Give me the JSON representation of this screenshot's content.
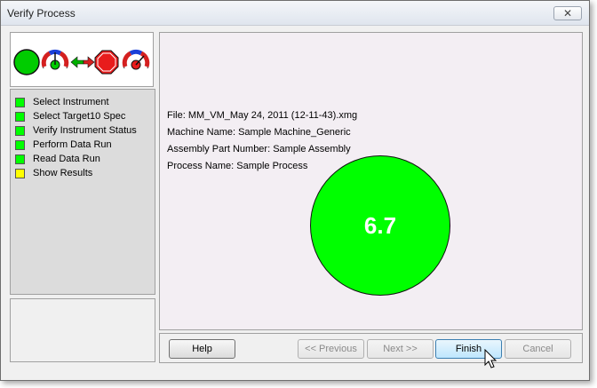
{
  "window": {
    "title": "Verify Process",
    "close_label": "✕"
  },
  "icons": [
    {
      "name": "green-light-icon"
    },
    {
      "name": "gauge-green-icon"
    },
    {
      "name": "double-arrow-icon"
    },
    {
      "name": "stop-sign-icon"
    },
    {
      "name": "gauge-red-icon"
    }
  ],
  "steps": [
    {
      "label": "Select Instrument",
      "status_color": "#00ff00"
    },
    {
      "label": "Select Target10 Spec",
      "status_color": "#00ff00"
    },
    {
      "label": "Verify Instrument Status",
      "status_color": "#00ff00"
    },
    {
      "label": "Perform Data Run",
      "status_color": "#00ff00"
    },
    {
      "label": "Read Data Run",
      "status_color": "#00ff00"
    },
    {
      "label": "Show Results",
      "status_color": "#ffff00"
    }
  ],
  "details": {
    "file": "File: MM_VM_May 24, 2011 (12-11-43).xmg",
    "machine": "Machine Name: Sample Machine_Generic",
    "assembly": "Assembly Part Number: Sample Assembly",
    "process": "Process Name: Sample Process"
  },
  "result": {
    "value": "6.7",
    "color": "#00ff00"
  },
  "buttons": {
    "help": "Help",
    "previous": "<< Previous",
    "next": "Next >>",
    "finish": "Finish",
    "cancel": "Cancel"
  }
}
